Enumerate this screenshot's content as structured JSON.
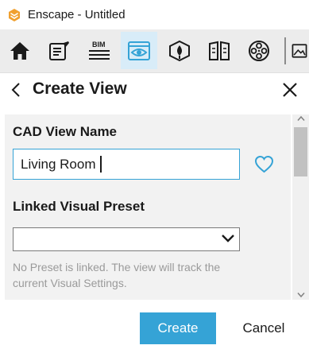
{
  "window": {
    "title": "Enscape - Untitled"
  },
  "toolbar": {
    "buttons": [
      {
        "icon": "home-icon",
        "active": false
      },
      {
        "icon": "notes-icon",
        "active": false
      },
      {
        "icon": "bim-icon",
        "label": "BIM",
        "active": false
      },
      {
        "icon": "views-icon",
        "active": true
      },
      {
        "icon": "site-context-icon",
        "active": false
      },
      {
        "icon": "book-icon",
        "active": false
      },
      {
        "icon": "film-reel-icon",
        "active": false
      },
      {
        "icon": "image-icon",
        "active": false
      }
    ]
  },
  "panel": {
    "title": "Create View"
  },
  "form": {
    "view_name_label": "CAD View Name",
    "view_name_value": "Living Room",
    "preset_label": "Linked Visual Preset",
    "preset_value": "",
    "help_text": "No Preset is linked. The view will track the current Visual Settings."
  },
  "actions": {
    "create_label": "Create",
    "cancel_label": "Cancel"
  },
  "colors": {
    "accent": "#35a3d6",
    "logo": "#f0a030",
    "toolbar_bg": "#ececec",
    "active_tab_bg": "#d8ecf8"
  }
}
